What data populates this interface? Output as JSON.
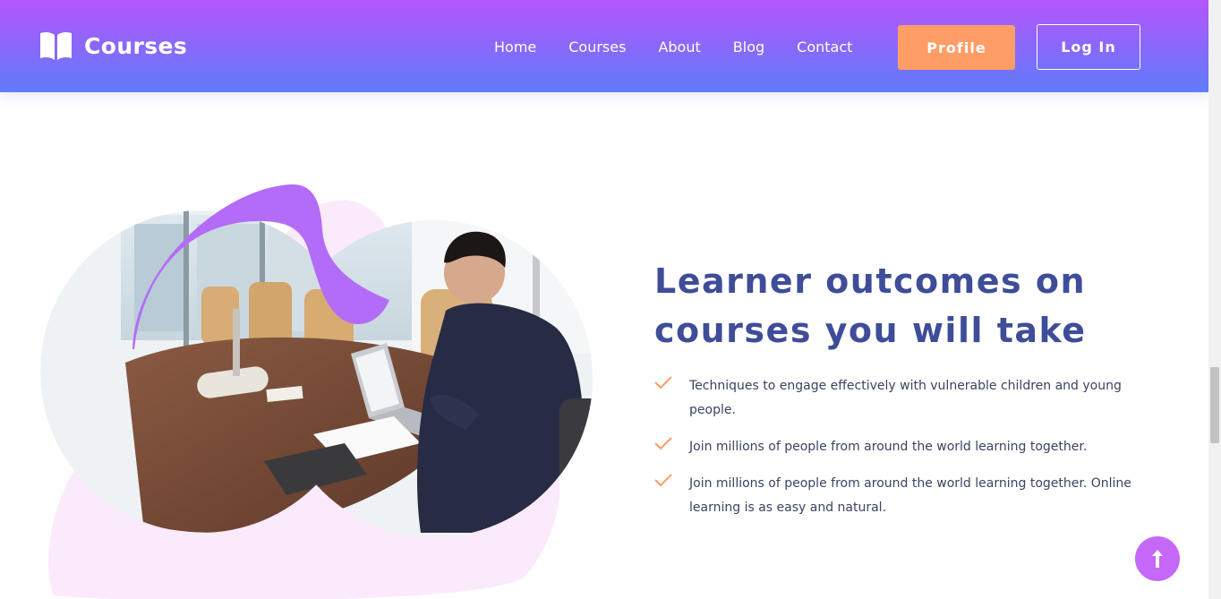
{
  "header": {
    "brand": "Courses",
    "brand_icon": "open-book-icon",
    "nav": [
      {
        "label": "Home"
      },
      {
        "label": "Courses"
      },
      {
        "label": "About"
      },
      {
        "label": "Blog"
      },
      {
        "label": "Contact"
      }
    ],
    "profile_label": "Profile",
    "login_label": "Log In",
    "gradient_top": "#b555fb",
    "gradient_bottom": "#5f7cfb"
  },
  "hero": {
    "heading_line1": "Learner outcomes on",
    "heading_line2": "courses you will take",
    "items": [
      {
        "text": "Techniques to engage effectively with vulnerable children and young people."
      },
      {
        "text": "Join millions of people from around the world learning together."
      },
      {
        "text": "Join millions of people from around the world learning together. Online learning is as easy and natural."
      }
    ],
    "check_icon": "checkmark-icon",
    "image_subject": "man working on laptop at conference table"
  },
  "colors": {
    "accent_orange": "#ff9d66",
    "heading_blue": "#3f4d99",
    "blob_pink": "#fbeafc",
    "ribbon_purple": "#b36cf7",
    "scroll_button": "#c568f8"
  },
  "scroll_top_icon": "arrow-up-icon"
}
